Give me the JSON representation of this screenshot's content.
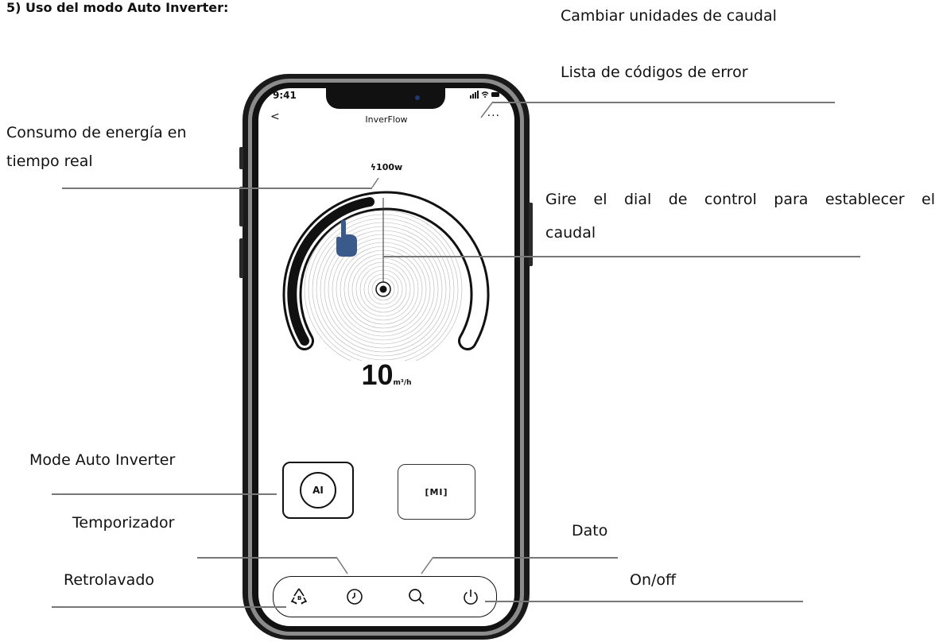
{
  "doc": {
    "section_title": "5)   Uso del modo Auto Inverter:",
    "labels": {
      "flow_units": "Cambiar unidades de caudal",
      "error_codes": "Lista de códigos de error",
      "energy_line1": "Consumo de energía en",
      "energy_line2": "tiempo real",
      "dial_line1": "Gire el dial de control para establecer el",
      "dial_line2": "caudal",
      "mode_auto": "Mode Auto Inverter",
      "timer": "Temporizador",
      "data": "Dato",
      "backwash": "Retrolavado",
      "onoff": "On/off"
    }
  },
  "phone": {
    "status_time": "9:41",
    "status_icons": "▮▮▮ ◠ ▬",
    "nav_back": "<",
    "app_title": "InverFlow",
    "menu_more": "···",
    "power_readout": "ϟ100w",
    "flow_value": "10",
    "flow_unit": "m³/h",
    "mode_ai_label": "AI",
    "mode_mi_label": "MI",
    "icons": {
      "backwash": "recycle-icon",
      "timer": "clock-icon",
      "data": "search-icon",
      "power": "power-icon",
      "hand": "hand-pointer-icon",
      "dial": "dial-icon"
    },
    "colors": {
      "hand": "#3a5a8c",
      "frame": "#1a1a1a",
      "ring": "#8b8b8b"
    }
  }
}
